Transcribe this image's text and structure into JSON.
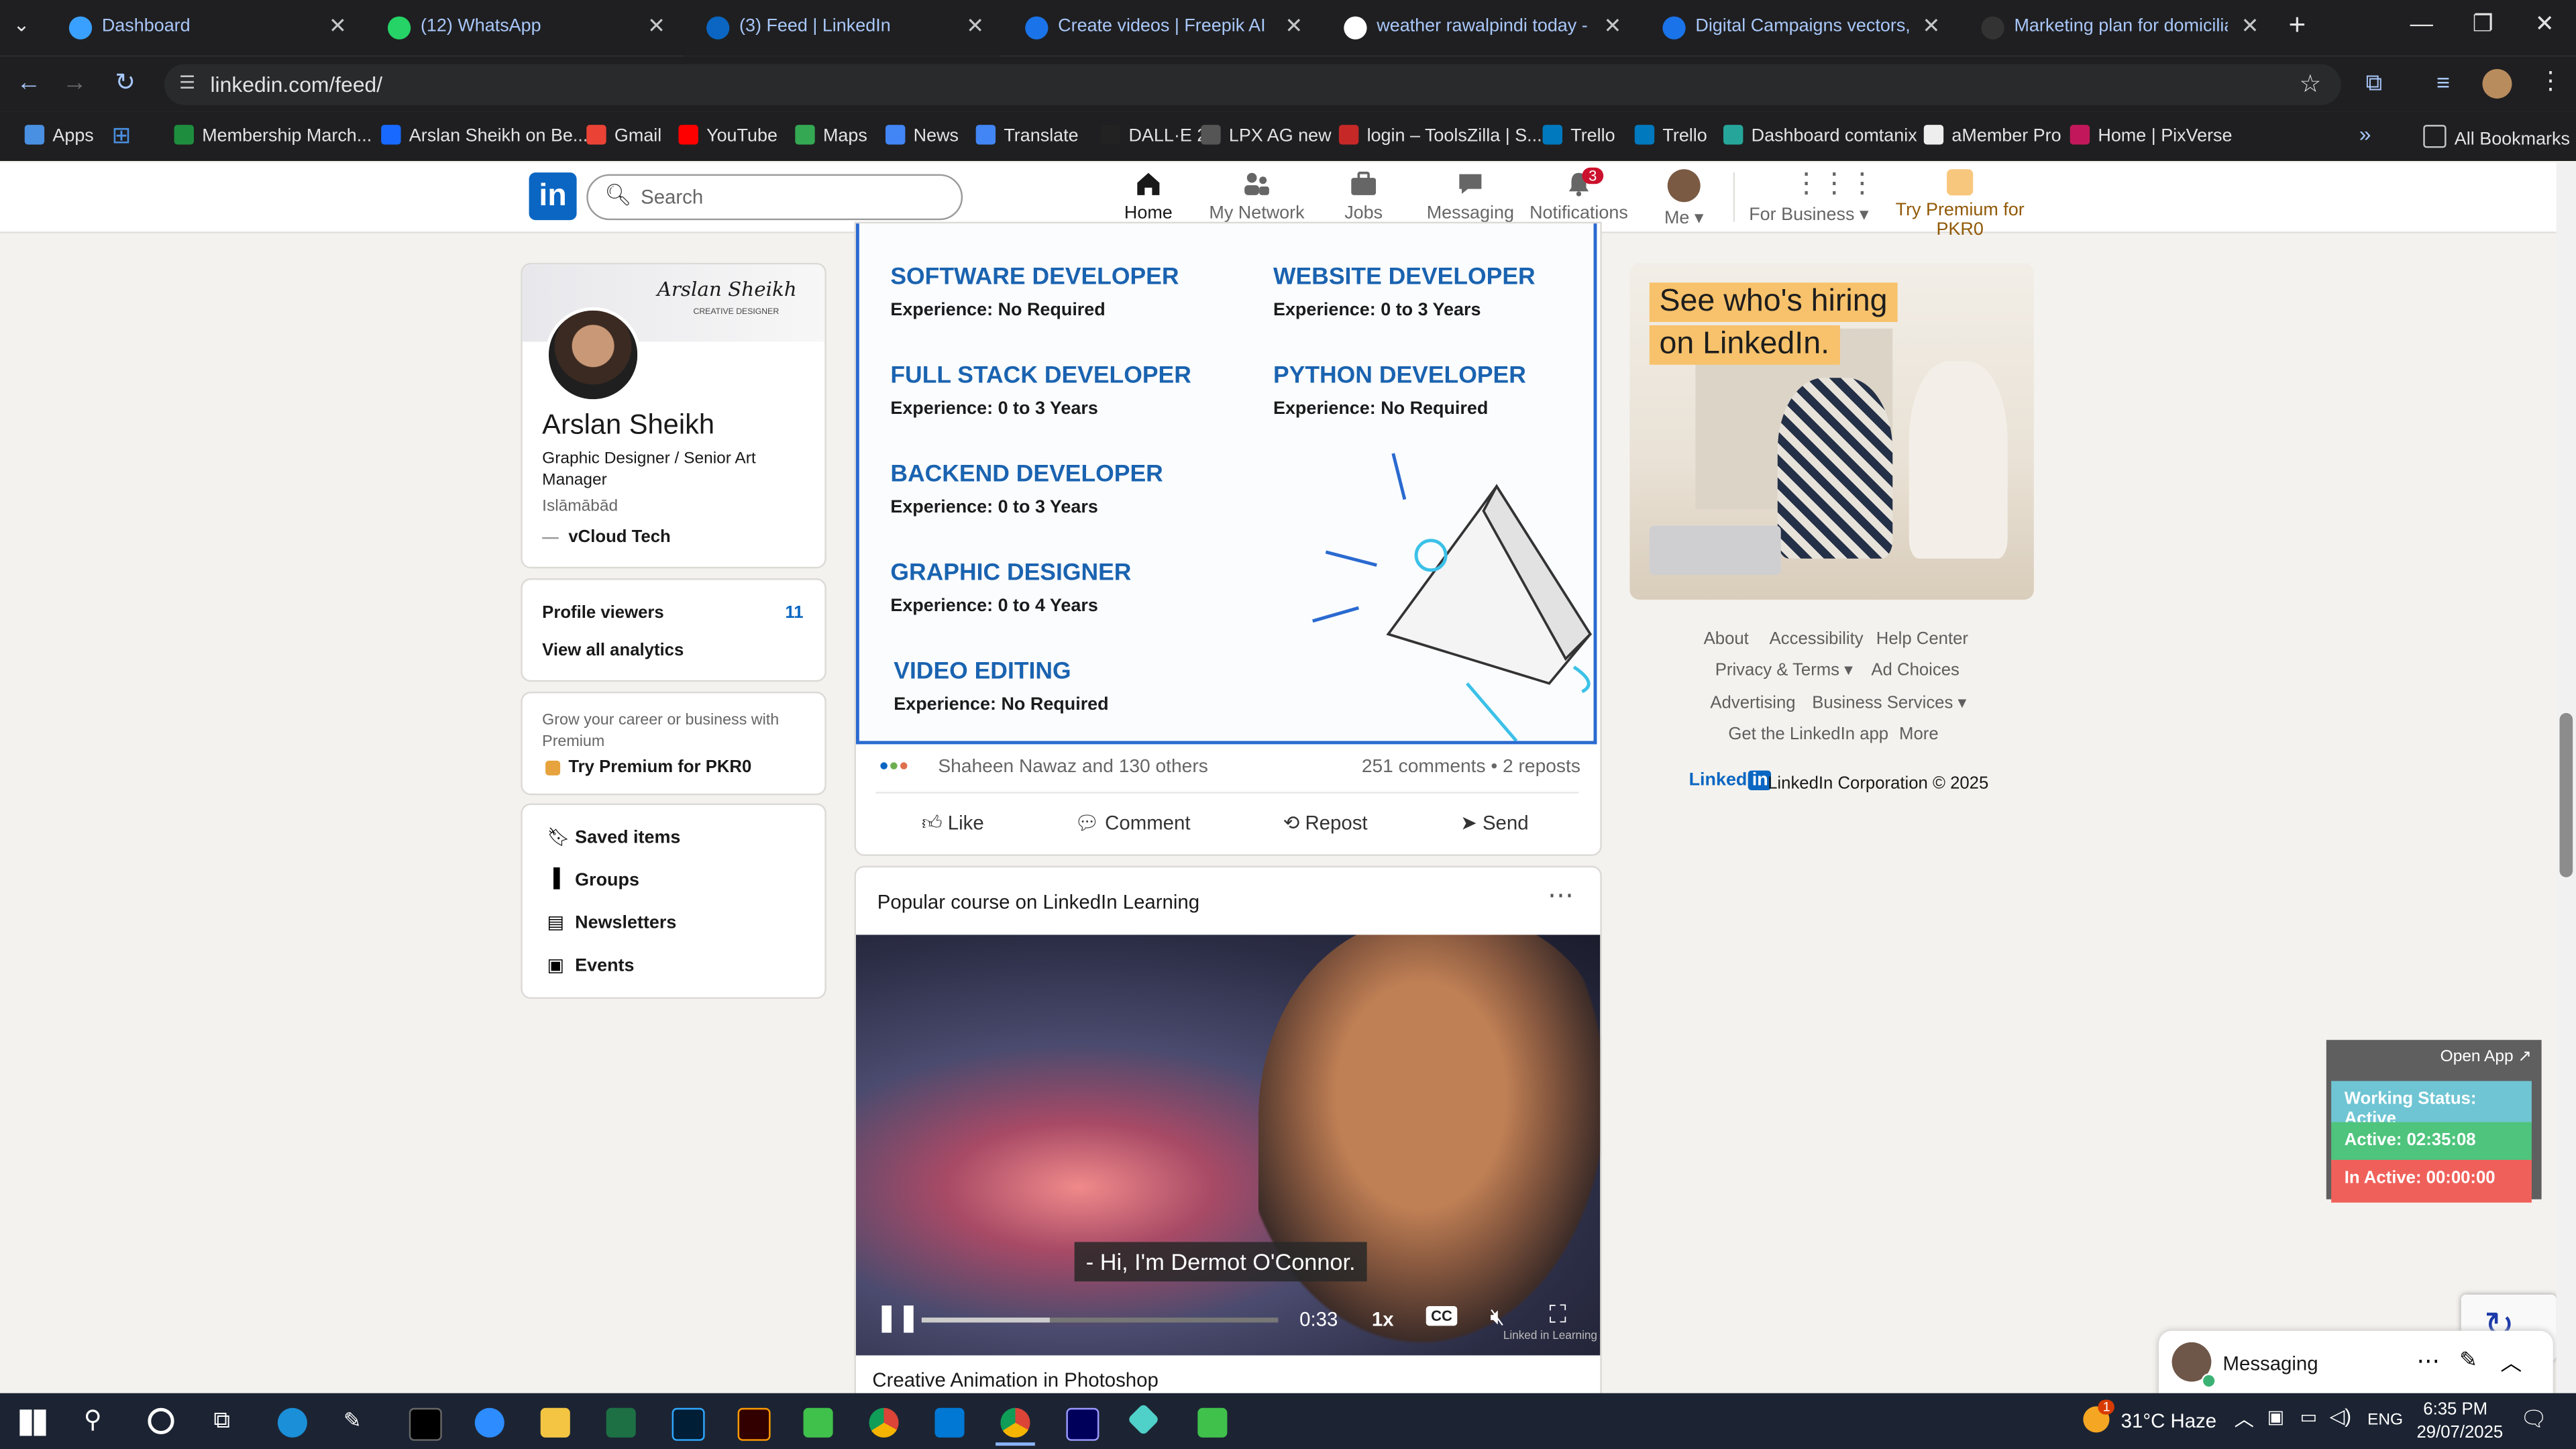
{
  "tabs": [
    {
      "title": "Dashboard",
      "color": "#3aa0ff"
    },
    {
      "title": "(12) WhatsApp",
      "color": "#25d366"
    },
    {
      "title": "(3) Feed | LinkedIn",
      "color": "#0a66c2"
    },
    {
      "title": "Create videos | Freepik AI",
      "color": "#1a73e8"
    },
    {
      "title": "weather rawalpindi today - Goo",
      "color": "#ffffff"
    },
    {
      "title": "Digital Campaigns vectors, pho",
      "color": "#1a73e8"
    },
    {
      "title": "Marketing plan for domiciliary",
      "color": "#333333"
    }
  ],
  "address": {
    "url": "linkedin.com/feed/"
  },
  "bookmarks": {
    "apps": "Apps",
    "items": [
      "Membership March...",
      "Arslan Sheikh on Be...",
      "Gmail",
      "YouTube",
      "Maps",
      "News",
      "Translate",
      "DALL·E 2",
      "LPX AG new",
      "login – ToolsZilla | S...",
      "Trello",
      "Trello",
      "Dashboard comtanix",
      "aMember Pro",
      "Home | PixVerse"
    ],
    "all": "All Bookmarks"
  },
  "linkedin_nav": {
    "search_placeholder": "Search",
    "home": "Home",
    "network": "My Network",
    "jobs": "Jobs",
    "messaging": "Messaging",
    "notifications": "Notifications",
    "notifications_badge": "3",
    "me": "Me",
    "business": "For Business",
    "premium": "Try Premium for PKR0"
  },
  "profile": {
    "banner_name": "Arslan Sheikh",
    "banner_role": "CREATIVE DESIGNER",
    "name": "Arslan Sheikh",
    "headline": "Graphic Designer / Senior Art Manager",
    "location": "Islāmābād",
    "company": "vCloud Tech",
    "viewers_label": "Profile viewers",
    "viewers_count": "11",
    "analytics": "View all analytics",
    "premium_text": "Grow your career or business with Premium",
    "premium_link": "Try Premium for PKR0",
    "links": [
      "Saved items",
      "Groups",
      "Newsletters",
      "Events"
    ]
  },
  "post": {
    "jobs": [
      {
        "title": "SOFTWARE DEVELOPER",
        "exp": "Experience: No Required"
      },
      {
        "title": "WEBSITE DEVELOPER",
        "exp": "Experience: 0 to 3 Years"
      },
      {
        "title": "FULL STACK DEVELOPER",
        "exp": "Experience: 0 to 3 Years"
      },
      {
        "title": "PYTHON DEVELOPER",
        "exp": "Experience: No Required"
      },
      {
        "title": "BACKEND DEVELOPER",
        "exp": "Experience: 0 to 3 Years"
      },
      {
        "title": "GRAPHIC DESIGNER",
        "exp": "Experience: 0 to 4 Years"
      },
      {
        "title": "VIDEO EDITING",
        "exp": "Experience: No Required"
      }
    ],
    "reactions": "Shaheen Nawaz and 130 others",
    "stats": "251 comments • 2 reposts",
    "actions": [
      "Like",
      "Comment",
      "Repost",
      "Send"
    ]
  },
  "course": {
    "heading": "Popular course on LinkedIn Learning",
    "caption": "- Hi, I'm Dermot O'Connor.",
    "time": "0:33",
    "speed": "1x",
    "progress": 0.36,
    "title": "Creative Animation in Photoshop",
    "watermark": "Linked in Learning"
  },
  "ad": {
    "line1": "See who's hiring",
    "line2": "on LinkedIn."
  },
  "footer": {
    "links": [
      "About",
      "Accessibility",
      "Help Center",
      "Privacy & Terms",
      "Ad Choices",
      "Advertising",
      "Business Services",
      "Get the LinkedIn app",
      "More"
    ],
    "brand": "Linked",
    "copyright": "LinkedIn Corporation © 2025"
  },
  "tracker": {
    "open": "Open App ↗",
    "status": "Working Status: Active",
    "active": "Active: 02:35:08",
    "inactive": "In Active: 00:00:00"
  },
  "messaging": {
    "label": "Messaging"
  },
  "taskbar": {
    "weather": "31°C Haze",
    "lang": "ENG",
    "time": "6:35 PM",
    "date": "29/07/2025",
    "weather_badge": "1"
  }
}
